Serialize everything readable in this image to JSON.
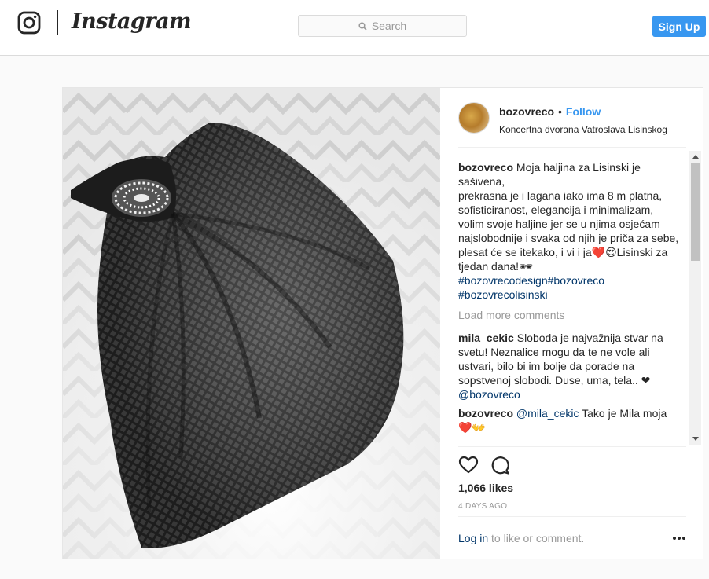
{
  "nav": {
    "logo_glyph": "instagram-camera-icon",
    "wordmark": "Instagram",
    "search_placeholder": "Search",
    "signup_label": "Sign Up",
    "accent": "#3897f0"
  },
  "post": {
    "image_alt": "black waffle-textured dress with rhinestone brooch on herringbone floor",
    "username": "bozovreco",
    "separator": "•",
    "follow_label": "Follow",
    "location": "Koncertna dvorana Vatroslava Lisinskog",
    "caption": {
      "user": "bozovreco",
      "line1": "Moja haljina za Lisinski je sašivena,",
      "line2": "prekrasna je i lagana iako ima 8 m platna,",
      "line3": "sofisticiranost, elegancija i minimalizam,",
      "line4": "volim svoje haljine jer se u njima osjećam najslobodnije i svaka od njih je priča za sebe,",
      "line5": "plesat će se itekako, i vi i ja❤️😍Lisinski za tjedan dana!🕶",
      "hashtag1": "#bozovrecodesign",
      "hashtag2": "#bozovreco",
      "hashtag3": "#bozovrecolisinski"
    },
    "load_more": "Load more comments",
    "comments": [
      {
        "user": "mila_cekic",
        "text": "Sloboda je najvažnija stvar na svetu! Neznalice mogu da te ne vole ali ustvari, bilo bi im bolje da porade na sopstvenoj slobodi. Duse, uma, tela.. ❤",
        "mention": "@bozovreco"
      },
      {
        "user": "bozovreco",
        "mention": "@mila_cekic",
        "text": "Tako je Mila moja ❤️👐"
      }
    ],
    "likes": "1,066 likes",
    "time": "4 DAYS AGO",
    "login_link": "Log in",
    "login_rest": "to like or comment."
  }
}
